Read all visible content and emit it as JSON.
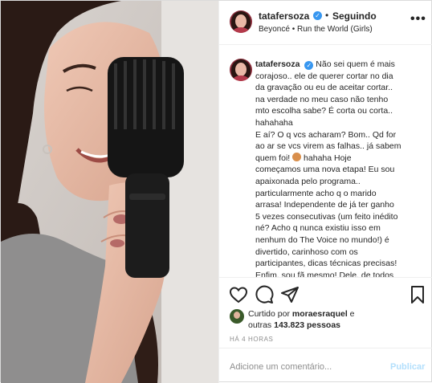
{
  "header": {
    "username": "tatafersoza",
    "follow_status": "Seguindo",
    "dot": "•",
    "music": "Beyoncé • Run the World (Girls)",
    "more": "•••"
  },
  "caption": {
    "username": "tatafersoza",
    "first_line": "Não sei quem é mais",
    "lines": [
      "corajoso.. ele de querer cortar no dia",
      "da gravação ou eu de aceitar cortar..",
      "na verdade no meu caso não tenho",
      "mto escolha sabe? É corta ou corta..",
      "hahahaha",
      "E aí? O q vcs acharam? Bom.. Qd for",
      "ao ar se vcs virem as falhas.. já sabem"
    ],
    "emoji_line_pre": "quem foi!",
    "emoji_line_post": "hahaha Hoje",
    "lines2": [
      "começamos uma nova etapa! Eu sou",
      "apaixonada pelo programa..",
      "particularmente acho q o marido",
      "arrasa! Independente de já ter ganho",
      "5 vezes consecutivas (um feito inédito",
      "né? Acho q nunca existiu isso em",
      "nenhum do The Voice no mundo!) é",
      "divertido, carinhoso com os",
      "participantes, dicas técnicas precisas!",
      "Enfim, sou fã mesmo! Dele, de todos"
    ]
  },
  "likes": {
    "prefix": "Curtido por",
    "user": "moraesraquel",
    "mid": "e",
    "others_prefix": "outras",
    "count": "143.823 pessoas"
  },
  "time": "HÁ 4 HORAS",
  "comment": {
    "placeholder": "Adicione um comentário...",
    "publish": "Publicar"
  },
  "icons": [
    "heart-icon",
    "comment-icon",
    "share-icon",
    "bookmark-icon",
    "verified-badge-icon"
  ],
  "colors": {
    "verified": "#3897f0",
    "publish_disabled": "#b2dffc",
    "muted": "#8e8e8e"
  }
}
